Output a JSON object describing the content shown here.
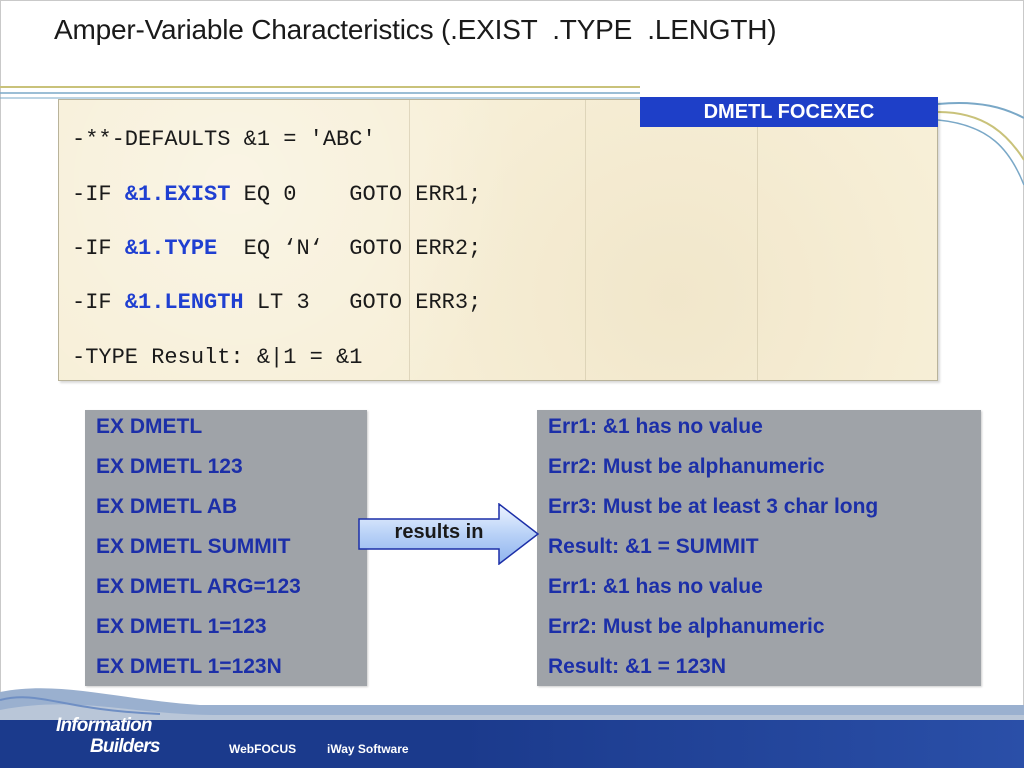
{
  "slide": {
    "title": "Amper-Variable Characteristics (.EXIST  .TYPE  .LENGTH)",
    "badge": "DMETL FOCEXEC"
  },
  "code": {
    "line1": "-**-DEFAULTS &1 = 'ABC'",
    "line2": {
      "pre": "-IF ",
      "kw": "&1.EXIST",
      "post": " EQ 0    GOTO ERR1;"
    },
    "line3": {
      "pre": "-IF ",
      "kw": "&1.TYPE",
      "post": "  EQ ‘N‘  GOTO ERR2;"
    },
    "line4": {
      "pre": "-IF ",
      "kw": "&1.LENGTH",
      "post": " LT 3   GOTO ERR3;"
    },
    "line5": "-TYPE Result: &|1 = &1"
  },
  "commands": [
    "EX DMETL",
    "EX DMETL 123",
    "EX DMETL AB",
    "EX DMETL SUMMIT",
    "EX DMETL ARG=123",
    "EX DMETL 1=123",
    "EX DMETL 1=123N"
  ],
  "arrow_label": "results in",
  "results": [
    "Err1: &1 has no value",
    "Err2: Must be alphanumeric",
    "Err3: Must be at least 3 char long",
    "Result: &1 = SUMMIT",
    "Err1: &1 has no value",
    "Err2: Must be alphanumeric",
    "Result: &1 = 123N"
  ],
  "footer": {
    "logo_line1": "Information",
    "logo_line2": "Builders",
    "links": [
      "WebFOCUS",
      "iWay Software"
    ]
  },
  "colors": {
    "accent_blue": "#1e3fc8",
    "keyword_blue": "#1f3fd1",
    "list_text": "#1c2fa8",
    "box_gray": "#9fa3a8",
    "code_bg": "#f7efd7",
    "footer_navy": "#1b3a8c"
  }
}
